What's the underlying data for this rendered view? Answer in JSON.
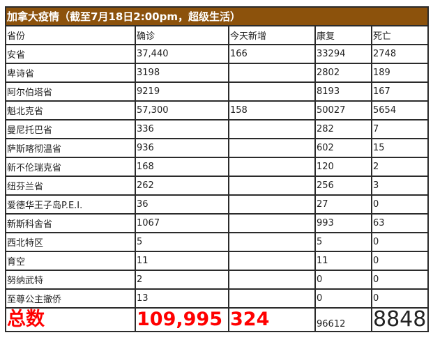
{
  "title": "加拿大疫情（截至7月18日2:00pm，超级生活）",
  "headers": [
    "省份",
    "确诊",
    "今天新增",
    "康复",
    "死亡"
  ],
  "rows": [
    [
      "安省",
      "37,440",
      "166",
      "33294",
      "2748"
    ],
    [
      "卑诗省",
      "3198",
      "",
      "2802",
      "189"
    ],
    [
      "阿尔伯塔省",
      "9219",
      "",
      "8193",
      "167"
    ],
    [
      "魁北克省",
      "57,300",
      "158",
      "50027",
      "5654"
    ],
    [
      "曼尼托巴省",
      "336",
      "",
      "282",
      "7"
    ],
    [
      "萨斯喀彻温省",
      "936",
      "",
      "602",
      "15"
    ],
    [
      "新不伦瑞克省",
      "168",
      "",
      "120",
      "2"
    ],
    [
      "纽芬兰省",
      "262",
      "",
      "256",
      "3"
    ],
    [
      "爱德华王子岛P.E.I.",
      "36",
      "",
      "27",
      "0"
    ],
    [
      "新斯科舍省",
      "1067",
      "",
      "993",
      "63"
    ],
    [
      "西北特区",
      "5",
      "",
      "5",
      "0"
    ],
    [
      "育空",
      "11",
      "",
      "11",
      "0"
    ],
    [
      "努纳武特",
      "2",
      "",
      "0",
      "0"
    ],
    [
      "至尊公主撤侨",
      "13",
      "",
      "0",
      "0"
    ]
  ],
  "total": {
    "label": "总数",
    "confirmed": "109,995",
    "new": "324",
    "recovered": "96612",
    "deaths": "8848"
  },
  "colors": {
    "title_bg": "#8c520c",
    "total_text": "#ff0000"
  }
}
